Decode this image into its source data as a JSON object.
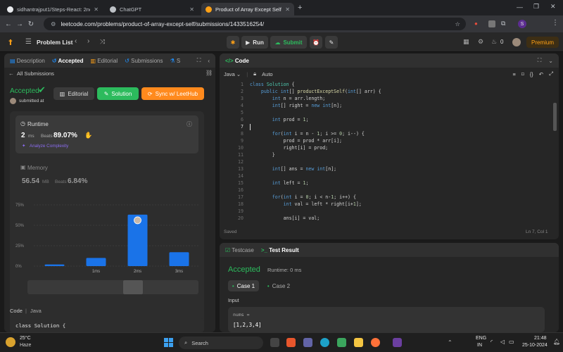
{
  "browser": {
    "tabs": [
      {
        "title": "sidhantrajput1/Steps-React: 2nd",
        "icon": "github-icon"
      },
      {
        "title": "ChatGPT",
        "icon": "chatgpt-icon"
      },
      {
        "title": "Product of Array Except Self - L",
        "icon": "leetcode-icon"
      }
    ],
    "url": "leetcode.com/problems/product-of-array-except-self/submissions/1433516254/",
    "profile_initial": "S"
  },
  "header": {
    "problem_list": "Problem List",
    "run": "Run",
    "submit": "Submit",
    "streak": "0",
    "premium": "Premium"
  },
  "left_panel": {
    "tabs": [
      "Description",
      "Accepted",
      "Editorial",
      "Submissions",
      "S"
    ],
    "all_submissions": "All Submissions",
    "status": "Accepted",
    "submitted": "submitted at",
    "editorial_btn": "Editorial",
    "solution_btn": "Solution",
    "sync_btn": "Sync w/ LeetHub",
    "runtime": {
      "label": "Runtime",
      "value": "2",
      "unit": "ms",
      "beats_label": "Beats",
      "beats": "89.07%",
      "analyze": "Analyze Complexity"
    },
    "memory": {
      "label": "Memory",
      "value": "56.54",
      "unit": "MB",
      "beats_label": "Beats",
      "beats": "6.84%"
    },
    "code_label": "Code",
    "lang": "Java",
    "code_preview": "class Solution {"
  },
  "chart_data": {
    "type": "bar",
    "categories": [
      "",
      "1ms",
      "2ms",
      "3ms"
    ],
    "values": [
      2,
      10,
      63,
      17
    ],
    "ylabel": "",
    "yticks": [
      "0%",
      "25%",
      "50%",
      "75%"
    ],
    "ylim": [
      0,
      75
    ],
    "highlight": "2ms",
    "color": "#1a73e8"
  },
  "editor": {
    "title": "Code",
    "lang": "Java",
    "mode": "Auto",
    "status": "Saved",
    "position": "Ln 7, Col 1",
    "lines": [
      "class Solution {",
      "    public int[] productExceptSelf(int[] arr) {",
      "        int n = arr.length;",
      "        int[] right = new int[n];",
      "",
      "        int prod = 1;",
      "",
      "        for(int i = n - 1; i >= 0; i--) {",
      "            prod = prod * arr[i];",
      "            right[i] = prod;",
      "        }",
      "",
      "        int[] ans = new int[n];",
      "",
      "        int left = 1;",
      "",
      "        for(int i = 0; i < n-1; i++) {",
      "            int val = left * right[i+1];",
      "",
      "            ans[i] = val;"
    ]
  },
  "result": {
    "tab_testcase": "Testcase",
    "tab_result": "Test Result",
    "status": "Accepted",
    "runtime": "Runtime: 0 ms",
    "cases": [
      "Case 1",
      "Case 2"
    ],
    "input_label": "Input",
    "var": "nums =",
    "value": "[1,2,3,4]"
  },
  "taskbar": {
    "temp": "25°C",
    "weather": "Haze",
    "search": "Search",
    "lang1": "ENG",
    "lang2": "IN",
    "time": "21:48",
    "date": "25-10-2024"
  }
}
